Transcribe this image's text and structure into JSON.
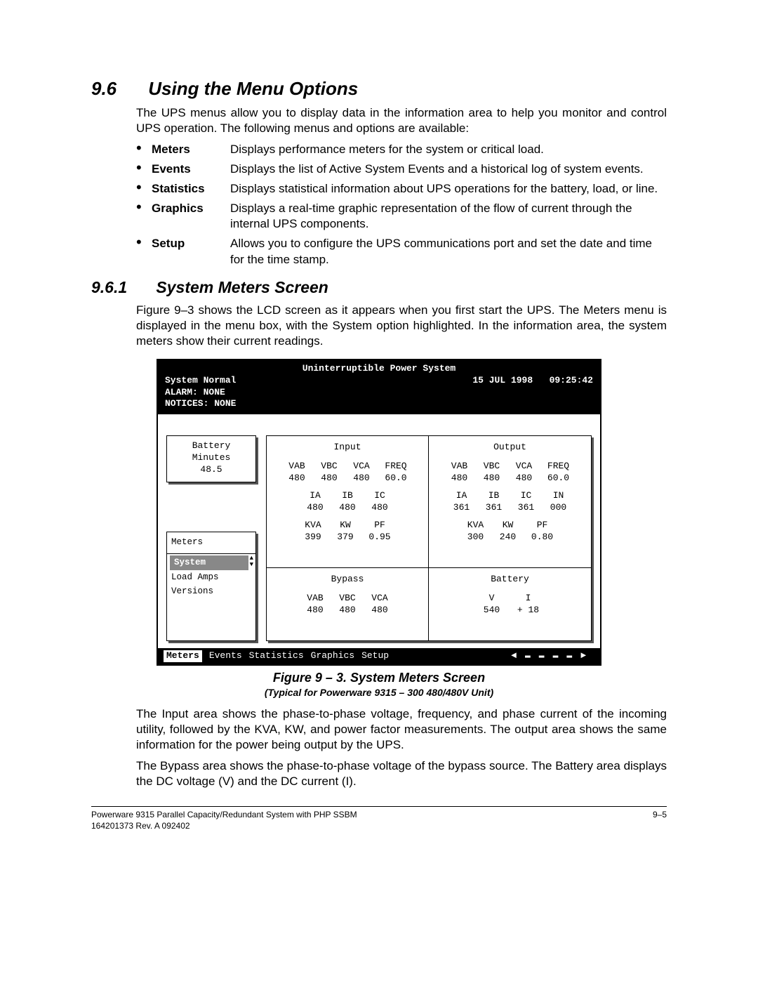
{
  "section": {
    "number": "9.6",
    "title": "Using the Menu Options",
    "intro": "The UPS menus allow you to display data in the information area to help you monitor and control UPS operation.  The following menus and options are available:"
  },
  "menu_items": [
    {
      "label": "Meters",
      "desc": "Displays performance meters for the system or critical load."
    },
    {
      "label": "Events",
      "desc": "Displays the list of Active System Events and a historical log of system events."
    },
    {
      "label": "Statistics",
      "desc": "Displays statistical information about UPS operations for the battery, load, or line."
    },
    {
      "label": "Graphics",
      "desc": "Displays a real-time graphic representation of the flow of current through the internal UPS components."
    },
    {
      "label": "Setup",
      "desc": "Allows you to configure the UPS communications port and set the date and time for the time stamp."
    }
  ],
  "subsection": {
    "number": "9.6.1",
    "title": "System Meters Screen",
    "para": "Figure 9–3 shows the LCD screen as it appears when you first start the UPS.  The Meters menu is displayed in the menu box, with the System option highlighted.  In the information area, the system meters show their current readings."
  },
  "lcd": {
    "title": "Uninterruptible Power System",
    "status": "System Normal",
    "alarm": "ALARM:  NONE",
    "notices": "NOTICES: NONE",
    "date": "15 JUL 1998",
    "time": "09:25:42",
    "battery_box": {
      "l1": "Battery",
      "l2": "Minutes",
      "l3": "48.5"
    },
    "meters_menu": {
      "title": "Meters",
      "items": [
        "System",
        "Load Amps",
        "Versions"
      ]
    },
    "input": {
      "title": "Input",
      "v_labels": [
        "VAB",
        "VBC",
        "VCA",
        "FREQ"
      ],
      "v_values": [
        "480",
        "480",
        "480",
        "60.0"
      ],
      "i_labels": [
        "IA",
        "IB",
        "IC"
      ],
      "i_values": [
        "480",
        "480",
        "480"
      ],
      "p_labels": [
        "KVA",
        "KW",
        "PF"
      ],
      "p_values": [
        "399",
        "379",
        "0.95"
      ]
    },
    "output": {
      "title": "Output",
      "v_labels": [
        "VAB",
        "VBC",
        "VCA",
        "FREQ"
      ],
      "v_values": [
        "480",
        "480",
        "480",
        "60.0"
      ],
      "i_labels": [
        "IA",
        "IB",
        "IC",
        "IN"
      ],
      "i_values": [
        "361",
        "361",
        "361",
        "000"
      ],
      "p_labels": [
        "KVA",
        "KW",
        "PF"
      ],
      "p_values": [
        "300",
        "240",
        "0.80"
      ]
    },
    "bypass": {
      "title": "Bypass",
      "v_labels": [
        "VAB",
        "VBC",
        "VCA"
      ],
      "v_values": [
        "480",
        "480",
        "480"
      ]
    },
    "battery": {
      "title": "Battery",
      "labels": [
        "V",
        "I"
      ],
      "values": [
        "540",
        "+ 18"
      ]
    },
    "bottom_menu": [
      "Meters",
      "Events",
      "Statistics",
      "Graphics",
      "Setup"
    ]
  },
  "caption": "Figure 9 – 3.   System Meters Screen",
  "subcaption": "(Typical for Powerware 9315 – 300 480/480V Unit)",
  "after_para1": "The Input area shows the phase-to-phase voltage, frequency, and phase current of the incoming utility, followed by the KVA, KW, and power factor measurements.  The output area shows the same information for the power being output by the UPS.",
  "after_para2": "The Bypass area shows the phase-to-phase voltage of the bypass source.  The Battery area displays the DC voltage (V) and the DC current (I).",
  "footer": {
    "left1": "Powerware 9315 Parallel Capacity/Redundant System with PHP SSBM",
    "left2": "164201373   Rev. A     092402",
    "right": "9–5"
  }
}
